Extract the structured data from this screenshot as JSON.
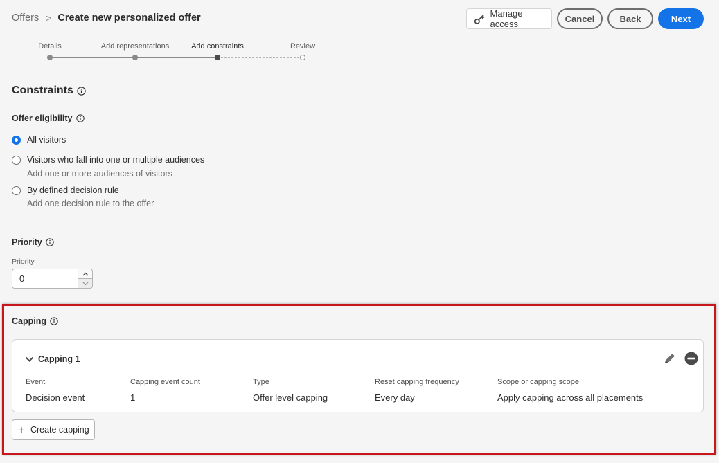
{
  "breadcrumb": {
    "parent": "Offers",
    "separator": ">",
    "current": "Create new personalized offer"
  },
  "header_buttons": {
    "manage_access": "Manage access",
    "cancel": "Cancel",
    "back": "Back",
    "next": "Next"
  },
  "steps": [
    {
      "label": "Details",
      "state": "done"
    },
    {
      "label": "Add representations",
      "state": "done"
    },
    {
      "label": "Add constraints",
      "state": "current"
    },
    {
      "label": "Review",
      "state": "todo"
    }
  ],
  "constraints": {
    "title": "Constraints",
    "eligibility_label": "Offer eligibility",
    "options": [
      {
        "label": "All visitors",
        "sub": "",
        "checked": true
      },
      {
        "label": "Visitors who fall into one or multiple audiences",
        "sub": "Add one or more audiences of visitors",
        "checked": false
      },
      {
        "label": "By defined decision rule",
        "sub": "Add one decision rule to the offer",
        "checked": false
      }
    ]
  },
  "priority": {
    "section_label": "Priority",
    "field_label": "Priority",
    "value": "0"
  },
  "capping": {
    "section_label": "Capping",
    "card_title": "Capping 1",
    "columns": [
      {
        "header": "Event",
        "value": "Decision event"
      },
      {
        "header": "Capping event count",
        "value": "1"
      },
      {
        "header": "Type",
        "value": "Offer level capping"
      },
      {
        "header": "Reset capping frequency",
        "value": "Every day"
      },
      {
        "header": "Scope or capping scope",
        "value": "Apply capping across all placements"
      }
    ],
    "create_label": "Create capping"
  },
  "icons": {
    "key": "key-icon",
    "info": "info-icon",
    "chevron": "chevron-down-icon",
    "edit": "pencil-icon",
    "remove": "remove-icon",
    "add": "plus-icon"
  },
  "colors": {
    "accent": "#1473e6",
    "highlight": "#c8171c"
  }
}
